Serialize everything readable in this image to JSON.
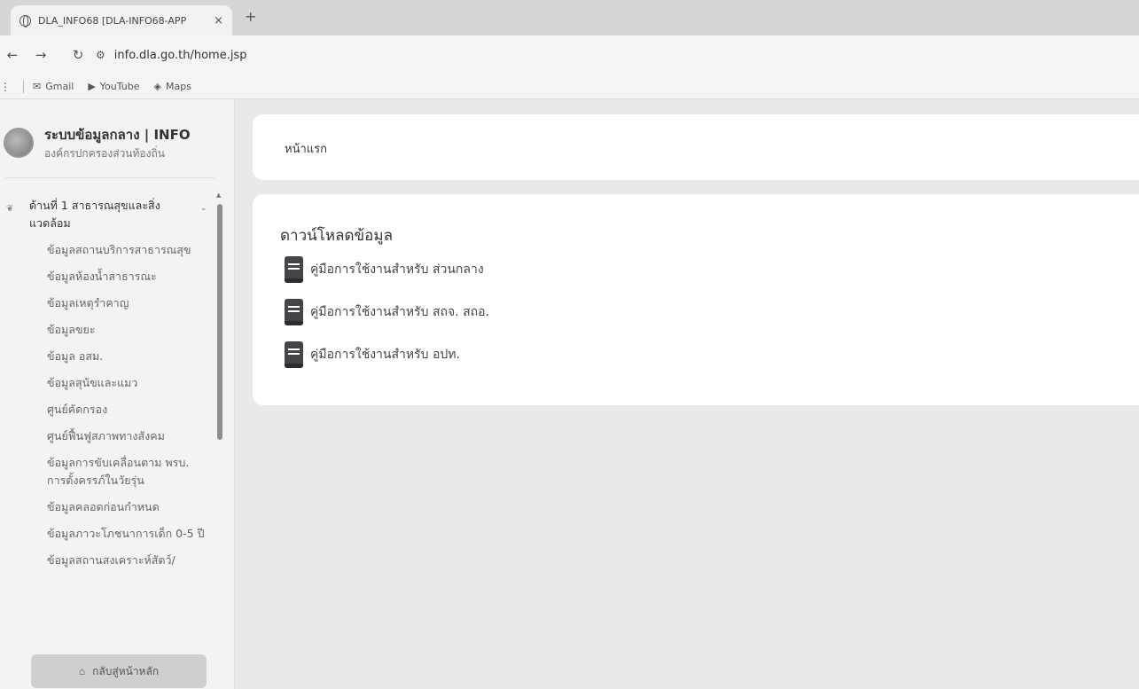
{
  "browser": {
    "tab_title": "DLA_INFO68 [DLA-INFO68-APP",
    "tab_close": "×",
    "new_tab": "+",
    "url": "info.dla.go.th/home.jsp",
    "back": "←",
    "forward": "→",
    "reload": "↻",
    "bookmarks": [
      {
        "label": "Gmail",
        "icon": "gmail-icon"
      },
      {
        "label": "YouTube",
        "icon": "youtube-icon"
      },
      {
        "label": "Maps",
        "icon": "maps-icon"
      }
    ]
  },
  "sidebar": {
    "brand_title": "ระบบข้อมูลกลาง | INFO",
    "brand_subtitle": "องค์กรปกครองส่วนท้องถิ่น",
    "group": {
      "label": "ด้านที่ 1 สาธารณสุขและสิ่งแวดล้อม",
      "items": [
        "ข้อมูลสถานบริการสาธารณสุข",
        "ข้อมูลห้องน้ำสาธารณะ",
        "ข้อมูลเหตุรำคาญ",
        "ข้อมูลขยะ",
        "ข้อมูล อสม.",
        "ข้อมูลสุนัขและแมว",
        "ศูนย์คัดกรอง",
        "ศูนย์ฟื้นฟูสภาพทางสังคม",
        "ข้อมูลการขับเคลื่อนตาม พรบ. การตั้งครรภ์ในวัยรุ่น",
        "ข้อมูลคลอดก่อนกำหนด",
        "ข้อมูลภาวะโภชนาการเด็ก 0-5 ปี",
        "ข้อมูลสถานสงเคราะห์สัตว์/"
      ]
    },
    "home_button": "กลับสู่หน้าหลัก"
  },
  "main": {
    "breadcrumb": "หน้าแรก",
    "download_title": "ดาวน์โหลดข้อมูล",
    "downloads": [
      "คู่มือการใช้งานสำหรับ ส่วนกลาง",
      "คู่มือการใช้งานสำหรับ สถจ. สถอ.",
      "คู่มือการใช้งานสำหรับ อปท."
    ]
  },
  "colors": {
    "sidebar_bg": "#f3f3f4",
    "main_bg": "#e9e9ea",
    "card_bg": "#ffffff",
    "doc_icon": "#444449"
  }
}
